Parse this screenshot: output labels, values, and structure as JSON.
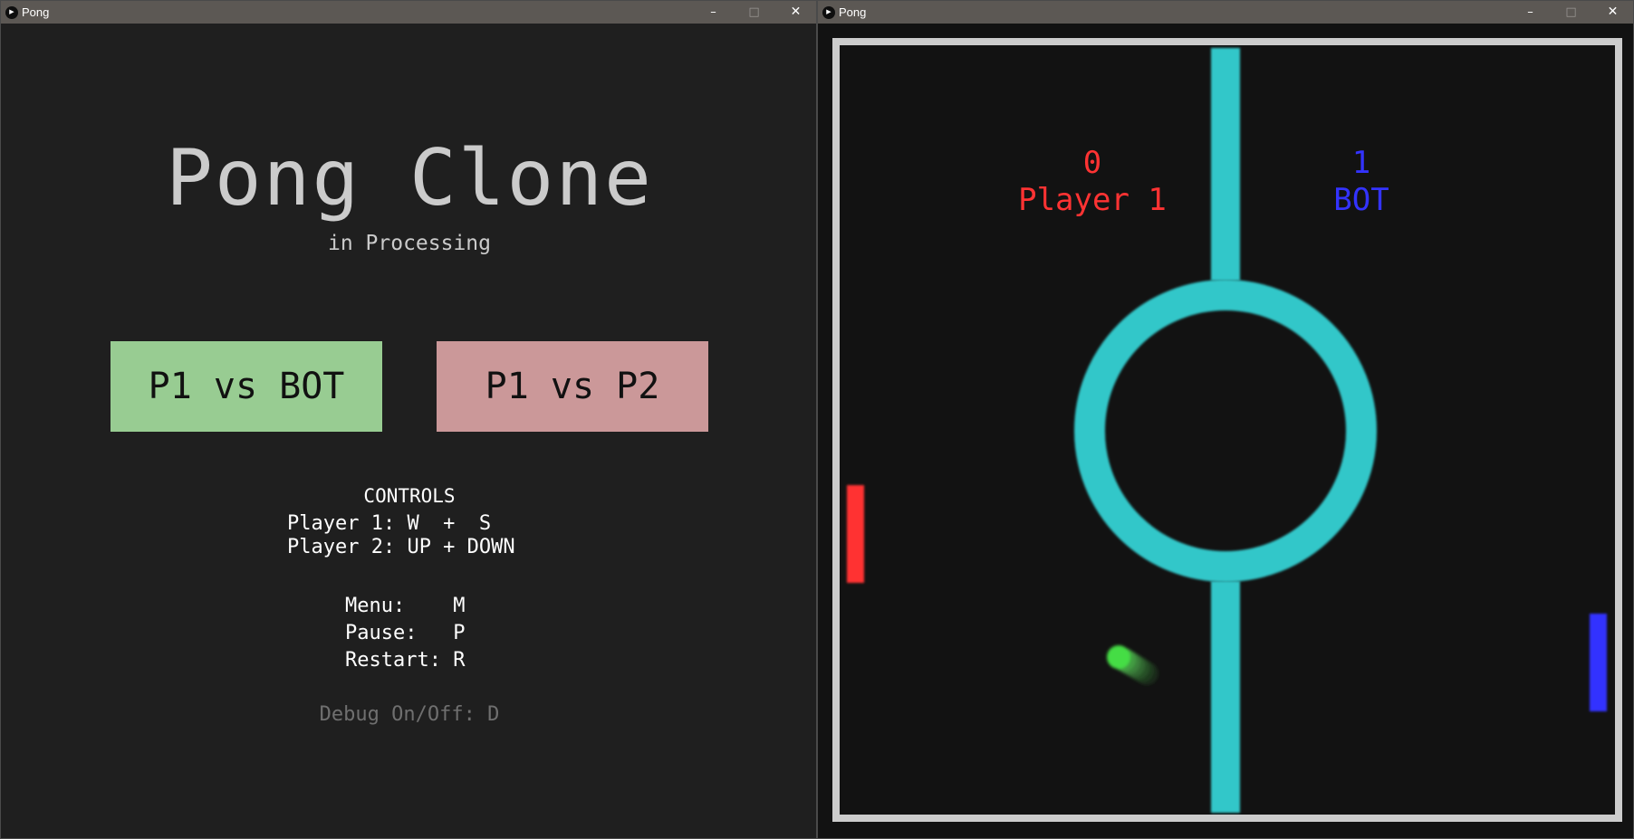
{
  "windows": [
    {
      "title": "Pong",
      "controls": {
        "minimize": "–",
        "maximize": "□",
        "close": "✕"
      }
    },
    {
      "title": "Pong",
      "controls": {
        "minimize": "–",
        "maximize": "□",
        "close": "✕"
      }
    }
  ],
  "menu": {
    "title": "Pong Clone",
    "subtitle": "in Processing",
    "buttons": {
      "bot": {
        "label": "P1 vs BOT",
        "color": "#98cc92"
      },
      "p2": {
        "label": "P1 vs P2",
        "color": "#cb9899"
      }
    },
    "controls_heading": "CONTROLS",
    "player1_controls": "Player 1: W  +  S",
    "player2_controls": "Player 2: UP + DOWN",
    "keys": {
      "menu": "Menu:    M",
      "pause": "Pause:   P",
      "restart": "Restart: R"
    },
    "debug": "Debug On/Off: D"
  },
  "game": {
    "player1": {
      "score": "0",
      "name": "Player 1",
      "color": "#ff3333"
    },
    "bot": {
      "score": "1",
      "name": "BOT",
      "color": "#3333ff"
    },
    "colors": {
      "background": "#121212",
      "border": "#cccccc",
      "center_line": "#33c7c9",
      "ball": "#44dd44"
    }
  }
}
